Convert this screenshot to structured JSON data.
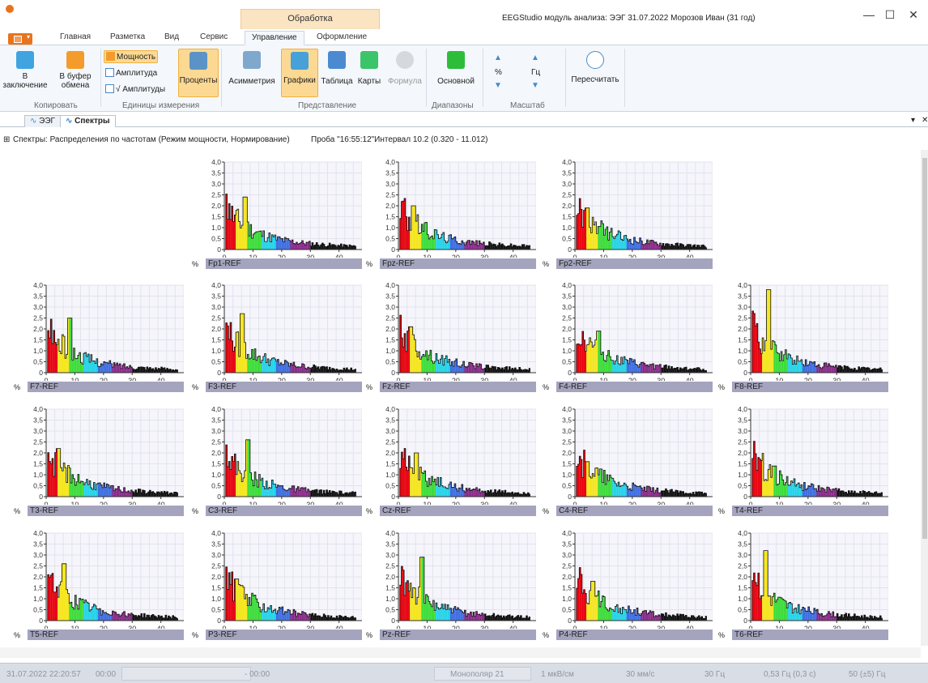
{
  "window": {
    "title": "EEGStudio модуль анализа: ЭЭГ 31.07.2022 Морозов Иван (31 год)",
    "context_tab": "Обработка",
    "minimize": "—",
    "maximize": "☐",
    "close": "✕"
  },
  "ribbon_tabs": [
    "Главная",
    "Разметка",
    "Вид",
    "Сервис",
    "Управление",
    "Оформление"
  ],
  "ribbon": {
    "copy_group": {
      "label": "Копировать",
      "to_report": "В заключение",
      "to_buffer": "В буфер обмена",
      "to_report_1": "В",
      "to_report_2": "заключение",
      "to_buffer_1": "В буфер",
      "to_buffer_2": "обмена"
    },
    "units_group": {
      "label": "Единицы измерения",
      "power": "Мощность",
      "amplitude": "Амплитуда",
      "sqrt_amplitude": "√ Амплитуды",
      "percent": "Проценты"
    },
    "view_group": {
      "label": "Представление",
      "asymmetry": "Асимметрия",
      "graphs": "Графики",
      "table": "Таблица",
      "maps": "Карты",
      "formula": "Формула"
    },
    "ranges_group": {
      "label": "Диапазоны",
      "basic": "Основной"
    },
    "scale_group": {
      "label": "Масштаб",
      "percent": "%",
      "hz": "Гц"
    },
    "recalc": "Пересчитать"
  },
  "doc_tabs": [
    "ЭЭГ",
    "Спектры"
  ],
  "info": {
    "title": "Спектры: Распределения по частотам (Режим мощности, Нормирование)",
    "probe": "Проба \"16:55:12\"Интервал 10.2 (0.320 - 11.012)"
  },
  "chart_data": {
    "type": "area",
    "ylabel": "%",
    "ylim": [
      0,
      4.0
    ],
    "xlim": [
      0,
      48
    ],
    "y_ticks": [
      "4,0",
      "3,5",
      "3,0",
      "2,5",
      "2,0",
      "1,5",
      "1,0",
      "0,5",
      "0"
    ],
    "x_ticks": [
      "0",
      "10",
      "20",
      "30",
      "40"
    ],
    "band_colors": [
      "#e8000c",
      "#f5e61c",
      "#3ddc3a",
      "#24d3e8",
      "#3d6de0",
      "#8a2a8a",
      "#111111"
    ],
    "band_edges_hz": [
      0.5,
      4,
      8,
      13,
      18,
      23,
      30,
      38,
      48
    ],
    "channels": [
      "Fp1-REF",
      "Fpz-REF",
      "Fp2-REF",
      "F7-REF",
      "F3-REF",
      "Fz-REF",
      "F4-REF",
      "F8-REF",
      "T3-REF",
      "C3-REF",
      "Cz-REF",
      "C4-REF",
      "T4-REF",
      "T5-REF",
      "P3-REF",
      "Pz-REF",
      "P4-REF",
      "T6-REF"
    ],
    "peaks": {
      "Fp1-REF": 2.4,
      "Fpz-REF": 2.0,
      "Fp2-REF": 1.9,
      "F7-REF": 2.5,
      "F3-REF": 2.7,
      "Fz-REF": 2.1,
      "F4-REF": 1.9,
      "F8-REF": 3.8,
      "T3-REF": 2.2,
      "C3-REF": 2.6,
      "Cz-REF": 2.0,
      "C4-REF": 1.6,
      "T4-REF": 1.4,
      "T5-REF": 2.6,
      "P3-REF": 1.9,
      "Pz-REF": 2.9,
      "P4-REF": 1.8,
      "T6-REF": 3.2
    }
  },
  "statusbar": {
    "datetime": "31.07.2022 22:20:57",
    "time1": "00:00",
    "time2": "- 00:00",
    "montage": "Монополяр 21",
    "sensitivity": "1 мкВ/см",
    "speed": "30 мм/с",
    "lowpass": "30 Гц",
    "highpass": "0,53 Гц (0,3 с)",
    "notch": "50 (±5) Гц"
  }
}
